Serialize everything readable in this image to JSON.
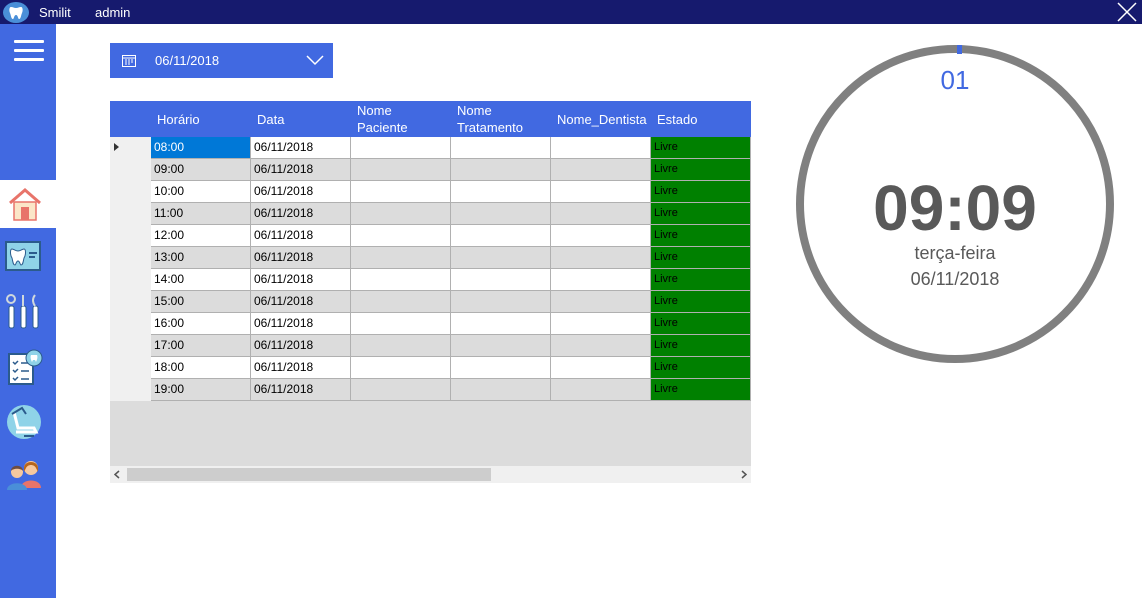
{
  "titlebar": {
    "app_name": "Smilit",
    "user": "admin"
  },
  "sidebar": {
    "items": [
      {
        "name": "home-icon",
        "active": true
      },
      {
        "name": "dental-xray-icon",
        "active": false
      },
      {
        "name": "dental-tools-icon",
        "active": false
      },
      {
        "name": "dental-clipboard-icon",
        "active": false
      },
      {
        "name": "dental-chair-icon",
        "active": false
      },
      {
        "name": "patients-icon",
        "active": false
      }
    ]
  },
  "datepicker": {
    "value": "06/11/2018"
  },
  "grid": {
    "columns": [
      "Horário",
      "Data",
      "Nome\nPaciente",
      "Nome\nTratamento",
      "Nome_Dentista",
      "Estado"
    ],
    "rows": [
      [
        "08:00",
        "06/11/2018",
        "",
        "",
        "",
        "Livre"
      ],
      [
        "09:00",
        "06/11/2018",
        "",
        "",
        "",
        "Livre"
      ],
      [
        "10:00",
        "06/11/2018",
        "",
        "",
        "",
        "Livre"
      ],
      [
        "11:00",
        "06/11/2018",
        "",
        "",
        "",
        "Livre"
      ],
      [
        "12:00",
        "06/11/2018",
        "",
        "",
        "",
        "Livre"
      ],
      [
        "13:00",
        "06/11/2018",
        "",
        "",
        "",
        "Livre"
      ],
      [
        "14:00",
        "06/11/2018",
        "",
        "",
        "",
        "Livre"
      ],
      [
        "15:00",
        "06/11/2018",
        "",
        "",
        "",
        "Livre"
      ],
      [
        "16:00",
        "06/11/2018",
        "",
        "",
        "",
        "Livre"
      ],
      [
        "17:00",
        "06/11/2018",
        "",
        "",
        "",
        "Livre"
      ],
      [
        "18:00",
        "06/11/2018",
        "",
        "",
        "",
        "Livre"
      ],
      [
        "19:00",
        "06/11/2018",
        "",
        "",
        "",
        "Livre"
      ]
    ],
    "status_color": "#008000"
  },
  "clock": {
    "seconds": "01",
    "time": "09:09",
    "weekday": "terça-feira",
    "date": "06/11/2018"
  },
  "colors": {
    "accent": "#4169e1",
    "titlebar": "#161a6e",
    "ring": "#808080"
  }
}
